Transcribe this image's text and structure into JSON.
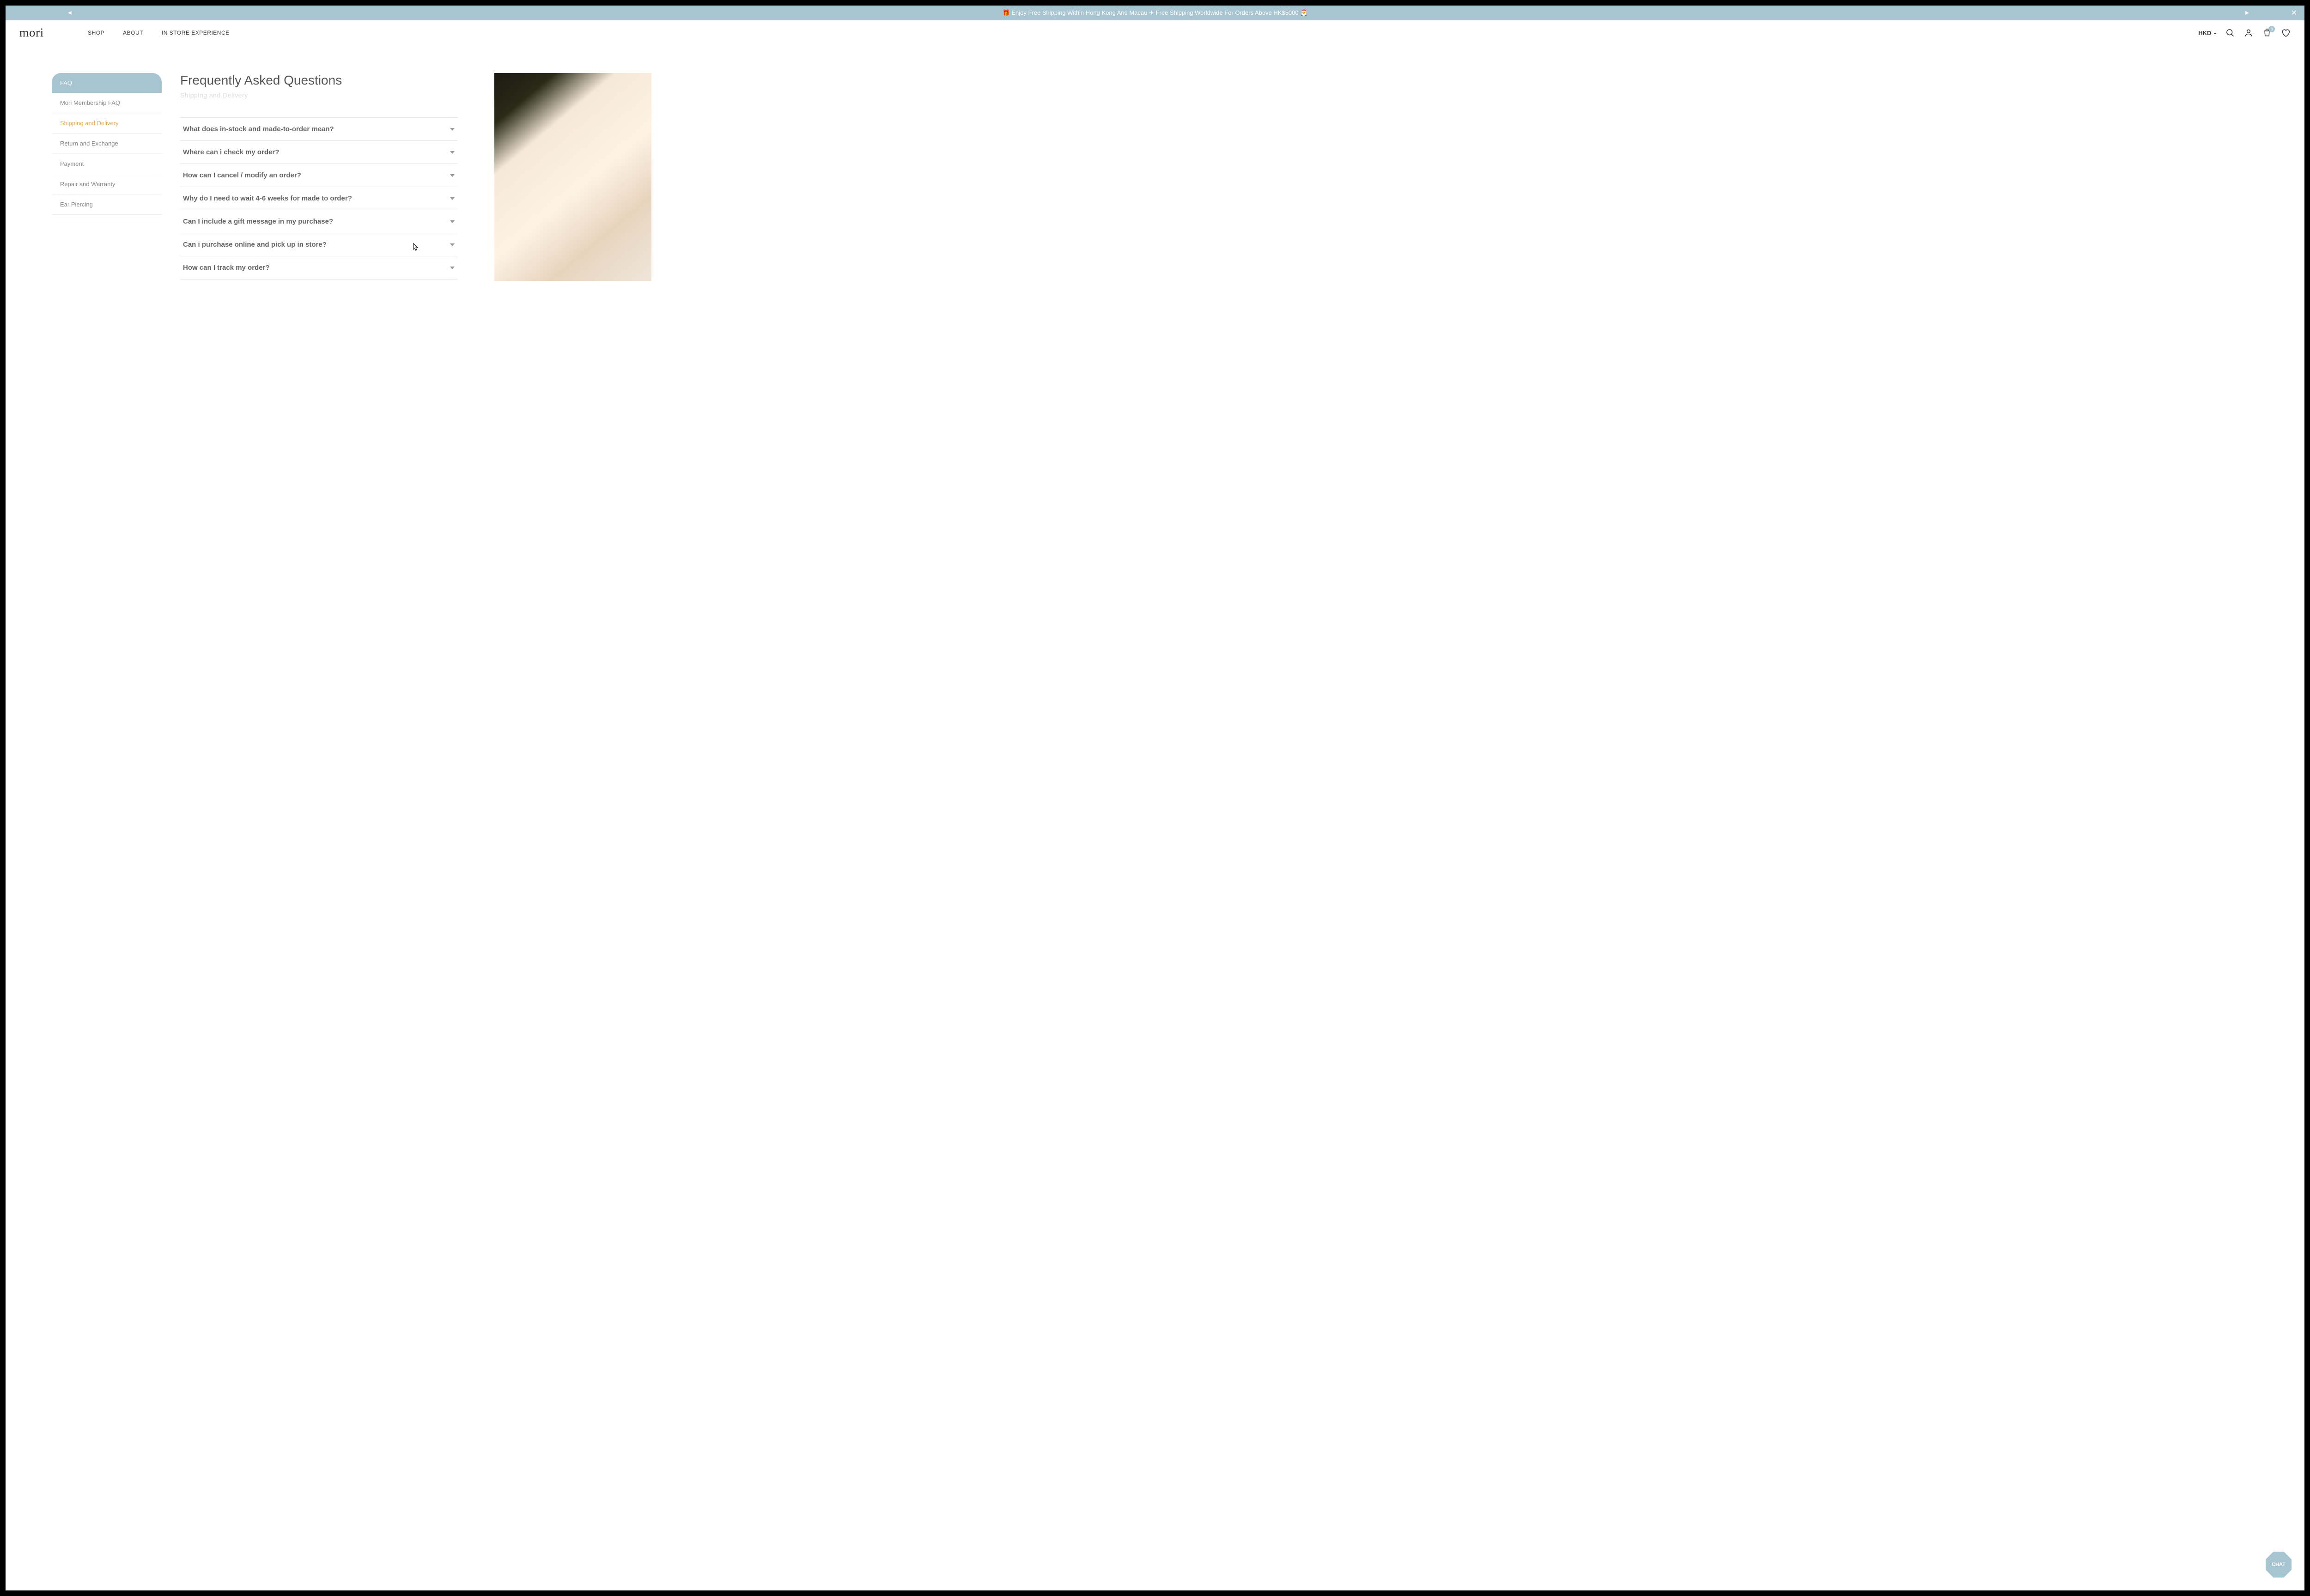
{
  "announce": {
    "text": "🎁 Enjoy Free Shipping Within Hong Kong And Macau ✈ Free Shipping Worldwide For Orders Above HK$5000 🎅"
  },
  "header": {
    "logo": "mori",
    "nav": {
      "shop": "SHOP",
      "about": "ABOUT",
      "instore": "IN STORE EXPERIENCE"
    },
    "currency": "HKD",
    "cart_count": "0"
  },
  "sidebar": {
    "items": [
      {
        "label": "FAQ"
      },
      {
        "label": "Mori Membership FAQ"
      },
      {
        "label": "Shipping and Delivery"
      },
      {
        "label": "Return and Exchange"
      },
      {
        "label": "Payment"
      },
      {
        "label": "Repair and Warranty"
      },
      {
        "label": "Ear Piercing"
      }
    ]
  },
  "faq": {
    "title": "Frequently Asked Questions",
    "subtitle": "Shipping and Delivery",
    "questions": [
      "What does in-stock and made-to-order mean?",
      "Where can i check my order?",
      "How can I cancel / modify an order?",
      "Why do I need to wait 4-6 weeks for made to order?",
      "Can I include a gift message in my purchase?",
      "Can i purchase online and pick up in store?",
      "How can I track my order?"
    ]
  },
  "chat": {
    "label": "CHAT"
  }
}
